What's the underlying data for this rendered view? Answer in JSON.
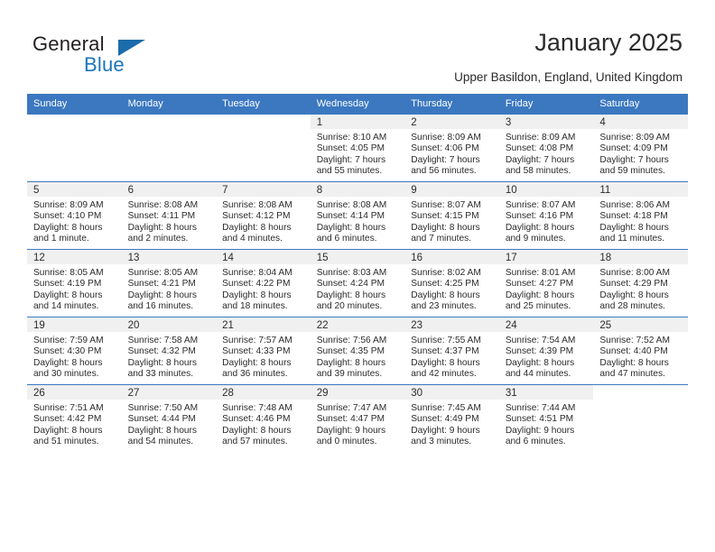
{
  "brand": {
    "name_part1": "General",
    "name_part2": "Blue"
  },
  "header": {
    "title": "January 2025",
    "location": "Upper Basildon, England, United Kingdom"
  },
  "colors": {
    "header_blue": "#3b78c0",
    "logo_blue": "#1b75bb",
    "cell_header_gray": "#f0f0f0"
  },
  "weekday_headers": [
    "Sunday",
    "Monday",
    "Tuesday",
    "Wednesday",
    "Thursday",
    "Friday",
    "Saturday"
  ],
  "weeks": [
    [
      {
        "day": "",
        "blank": true
      },
      {
        "day": "",
        "blank": true
      },
      {
        "day": "",
        "blank": true
      },
      {
        "day": "1",
        "sunrise": "Sunrise: 8:10 AM",
        "sunset": "Sunset: 4:05 PM",
        "daylight1": "Daylight: 7 hours",
        "daylight2": "and 55 minutes."
      },
      {
        "day": "2",
        "sunrise": "Sunrise: 8:09 AM",
        "sunset": "Sunset: 4:06 PM",
        "daylight1": "Daylight: 7 hours",
        "daylight2": "and 56 minutes."
      },
      {
        "day": "3",
        "sunrise": "Sunrise: 8:09 AM",
        "sunset": "Sunset: 4:08 PM",
        "daylight1": "Daylight: 7 hours",
        "daylight2": "and 58 minutes."
      },
      {
        "day": "4",
        "sunrise": "Sunrise: 8:09 AM",
        "sunset": "Sunset: 4:09 PM",
        "daylight1": "Daylight: 7 hours",
        "daylight2": "and 59 minutes."
      }
    ],
    [
      {
        "day": "5",
        "sunrise": "Sunrise: 8:09 AM",
        "sunset": "Sunset: 4:10 PM",
        "daylight1": "Daylight: 8 hours",
        "daylight2": "and 1 minute."
      },
      {
        "day": "6",
        "sunrise": "Sunrise: 8:08 AM",
        "sunset": "Sunset: 4:11 PM",
        "daylight1": "Daylight: 8 hours",
        "daylight2": "and 2 minutes."
      },
      {
        "day": "7",
        "sunrise": "Sunrise: 8:08 AM",
        "sunset": "Sunset: 4:12 PM",
        "daylight1": "Daylight: 8 hours",
        "daylight2": "and 4 minutes."
      },
      {
        "day": "8",
        "sunrise": "Sunrise: 8:08 AM",
        "sunset": "Sunset: 4:14 PM",
        "daylight1": "Daylight: 8 hours",
        "daylight2": "and 6 minutes."
      },
      {
        "day": "9",
        "sunrise": "Sunrise: 8:07 AM",
        "sunset": "Sunset: 4:15 PM",
        "daylight1": "Daylight: 8 hours",
        "daylight2": "and 7 minutes."
      },
      {
        "day": "10",
        "sunrise": "Sunrise: 8:07 AM",
        "sunset": "Sunset: 4:16 PM",
        "daylight1": "Daylight: 8 hours",
        "daylight2": "and 9 minutes."
      },
      {
        "day": "11",
        "sunrise": "Sunrise: 8:06 AM",
        "sunset": "Sunset: 4:18 PM",
        "daylight1": "Daylight: 8 hours",
        "daylight2": "and 11 minutes."
      }
    ],
    [
      {
        "day": "12",
        "sunrise": "Sunrise: 8:05 AM",
        "sunset": "Sunset: 4:19 PM",
        "daylight1": "Daylight: 8 hours",
        "daylight2": "and 14 minutes."
      },
      {
        "day": "13",
        "sunrise": "Sunrise: 8:05 AM",
        "sunset": "Sunset: 4:21 PM",
        "daylight1": "Daylight: 8 hours",
        "daylight2": "and 16 minutes."
      },
      {
        "day": "14",
        "sunrise": "Sunrise: 8:04 AM",
        "sunset": "Sunset: 4:22 PM",
        "daylight1": "Daylight: 8 hours",
        "daylight2": "and 18 minutes."
      },
      {
        "day": "15",
        "sunrise": "Sunrise: 8:03 AM",
        "sunset": "Sunset: 4:24 PM",
        "daylight1": "Daylight: 8 hours",
        "daylight2": "and 20 minutes."
      },
      {
        "day": "16",
        "sunrise": "Sunrise: 8:02 AM",
        "sunset": "Sunset: 4:25 PM",
        "daylight1": "Daylight: 8 hours",
        "daylight2": "and 23 minutes."
      },
      {
        "day": "17",
        "sunrise": "Sunrise: 8:01 AM",
        "sunset": "Sunset: 4:27 PM",
        "daylight1": "Daylight: 8 hours",
        "daylight2": "and 25 minutes."
      },
      {
        "day": "18",
        "sunrise": "Sunrise: 8:00 AM",
        "sunset": "Sunset: 4:29 PM",
        "daylight1": "Daylight: 8 hours",
        "daylight2": "and 28 minutes."
      }
    ],
    [
      {
        "day": "19",
        "sunrise": "Sunrise: 7:59 AM",
        "sunset": "Sunset: 4:30 PM",
        "daylight1": "Daylight: 8 hours",
        "daylight2": "and 30 minutes."
      },
      {
        "day": "20",
        "sunrise": "Sunrise: 7:58 AM",
        "sunset": "Sunset: 4:32 PM",
        "daylight1": "Daylight: 8 hours",
        "daylight2": "and 33 minutes."
      },
      {
        "day": "21",
        "sunrise": "Sunrise: 7:57 AM",
        "sunset": "Sunset: 4:33 PM",
        "daylight1": "Daylight: 8 hours",
        "daylight2": "and 36 minutes."
      },
      {
        "day": "22",
        "sunrise": "Sunrise: 7:56 AM",
        "sunset": "Sunset: 4:35 PM",
        "daylight1": "Daylight: 8 hours",
        "daylight2": "and 39 minutes."
      },
      {
        "day": "23",
        "sunrise": "Sunrise: 7:55 AM",
        "sunset": "Sunset: 4:37 PM",
        "daylight1": "Daylight: 8 hours",
        "daylight2": "and 42 minutes."
      },
      {
        "day": "24",
        "sunrise": "Sunrise: 7:54 AM",
        "sunset": "Sunset: 4:39 PM",
        "daylight1": "Daylight: 8 hours",
        "daylight2": "and 44 minutes."
      },
      {
        "day": "25",
        "sunrise": "Sunrise: 7:52 AM",
        "sunset": "Sunset: 4:40 PM",
        "daylight1": "Daylight: 8 hours",
        "daylight2": "and 47 minutes."
      }
    ],
    [
      {
        "day": "26",
        "sunrise": "Sunrise: 7:51 AM",
        "sunset": "Sunset: 4:42 PM",
        "daylight1": "Daylight: 8 hours",
        "daylight2": "and 51 minutes."
      },
      {
        "day": "27",
        "sunrise": "Sunrise: 7:50 AM",
        "sunset": "Sunset: 4:44 PM",
        "daylight1": "Daylight: 8 hours",
        "daylight2": "and 54 minutes."
      },
      {
        "day": "28",
        "sunrise": "Sunrise: 7:48 AM",
        "sunset": "Sunset: 4:46 PM",
        "daylight1": "Daylight: 8 hours",
        "daylight2": "and 57 minutes."
      },
      {
        "day": "29",
        "sunrise": "Sunrise: 7:47 AM",
        "sunset": "Sunset: 4:47 PM",
        "daylight1": "Daylight: 9 hours",
        "daylight2": "and 0 minutes."
      },
      {
        "day": "30",
        "sunrise": "Sunrise: 7:45 AM",
        "sunset": "Sunset: 4:49 PM",
        "daylight1": "Daylight: 9 hours",
        "daylight2": "and 3 minutes."
      },
      {
        "day": "31",
        "sunrise": "Sunrise: 7:44 AM",
        "sunset": "Sunset: 4:51 PM",
        "daylight1": "Daylight: 9 hours",
        "daylight2": "and 6 minutes."
      },
      {
        "day": "",
        "blank": true
      }
    ]
  ]
}
